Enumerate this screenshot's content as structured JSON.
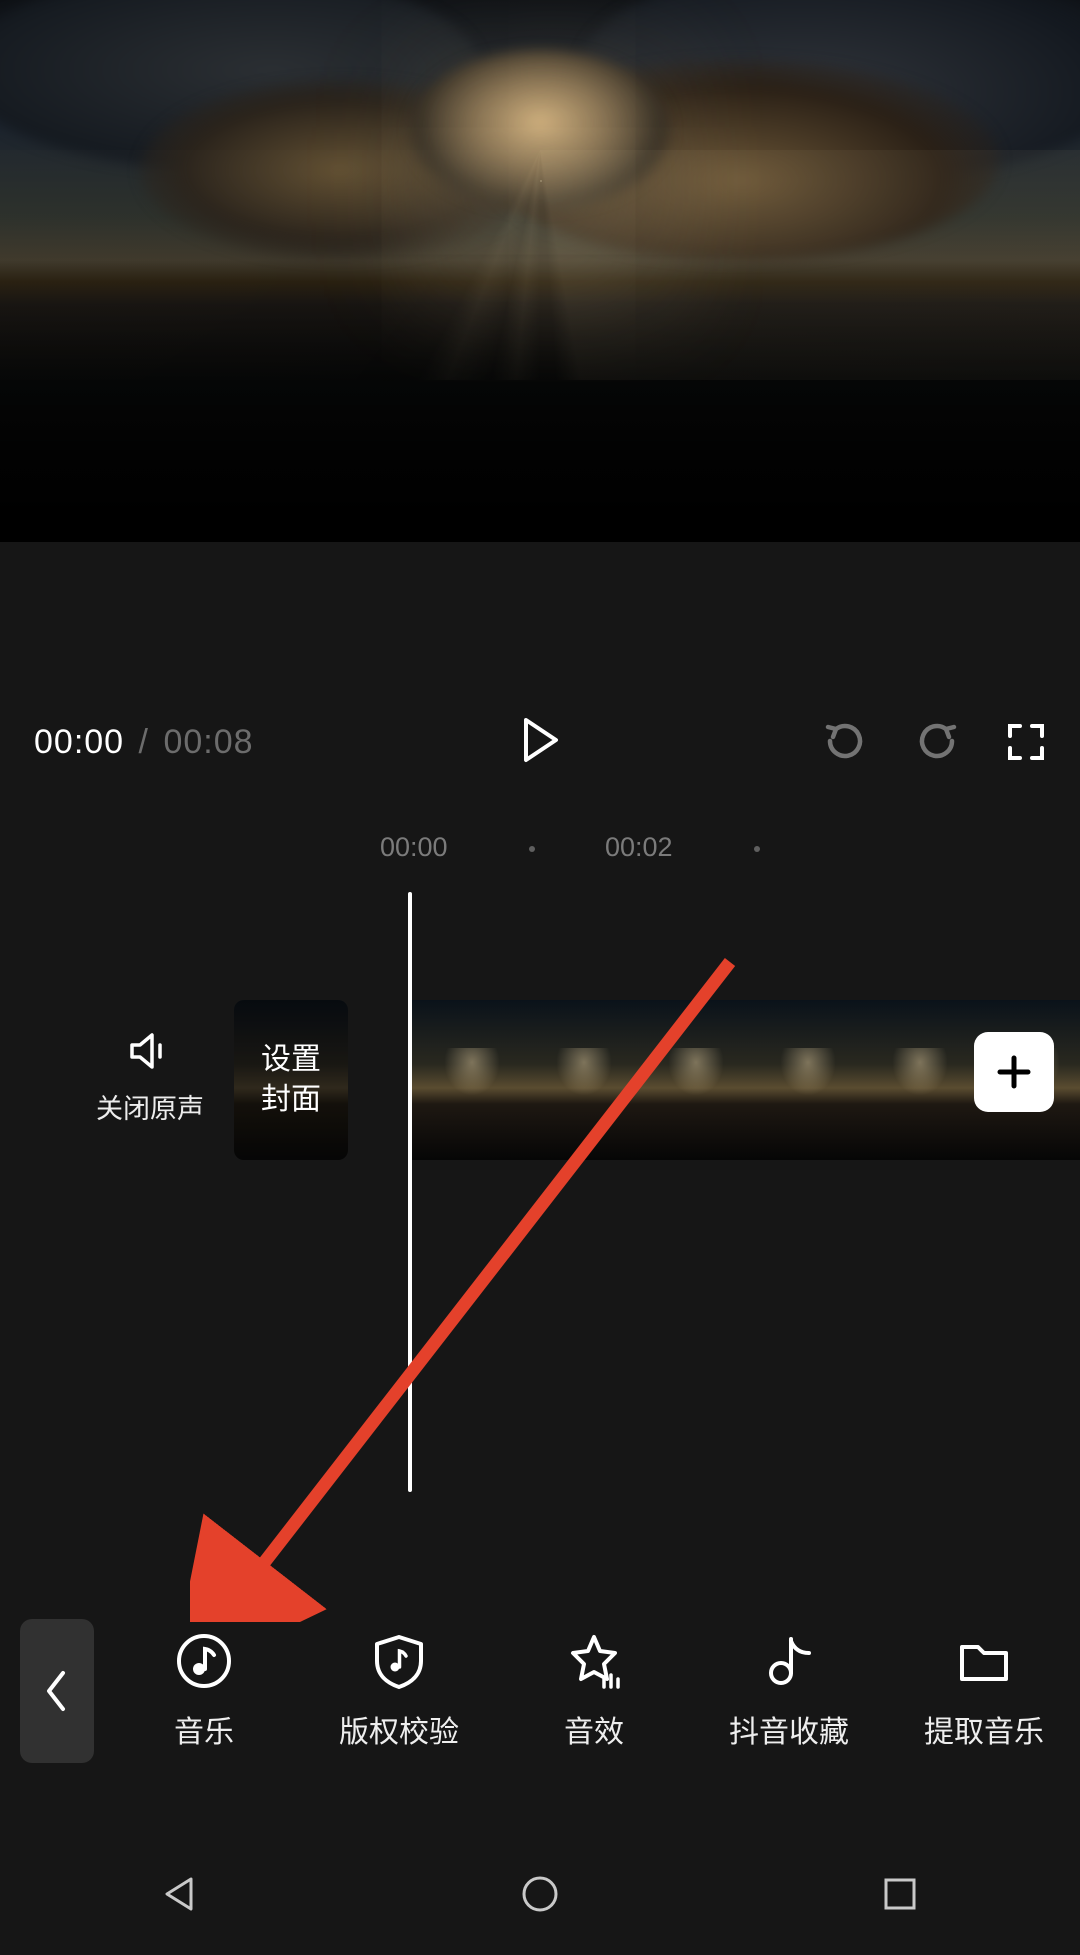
{
  "time": {
    "current": "00:00",
    "separator": "/",
    "duration": "00:08"
  },
  "ruler": {
    "t0": "00:00",
    "t2": "00:02"
  },
  "original_sound": {
    "label": "关闭原声"
  },
  "cover": {
    "line1": "设置",
    "line2": "封面"
  },
  "toolbar": {
    "music": "音乐",
    "copyright": "版权校验",
    "soundfx": "音效",
    "douyin_fav": "抖音收藏",
    "extract": "提取音乐"
  },
  "icons": {
    "play": "play-icon",
    "undo": "undo-icon",
    "redo": "redo-icon",
    "fullscreen": "fullscreen-icon",
    "speaker": "speaker-icon",
    "plus": "plus-icon",
    "chevron_left": "chevron-left-icon",
    "music": "music-note-circle-icon",
    "shield": "shield-music-icon",
    "star": "star-bars-icon",
    "tiktok": "tiktok-music-icon",
    "folder": "folder-icon",
    "nav_back": "triangle-left-icon",
    "nav_home": "circle-icon",
    "nav_recent": "square-icon"
  }
}
